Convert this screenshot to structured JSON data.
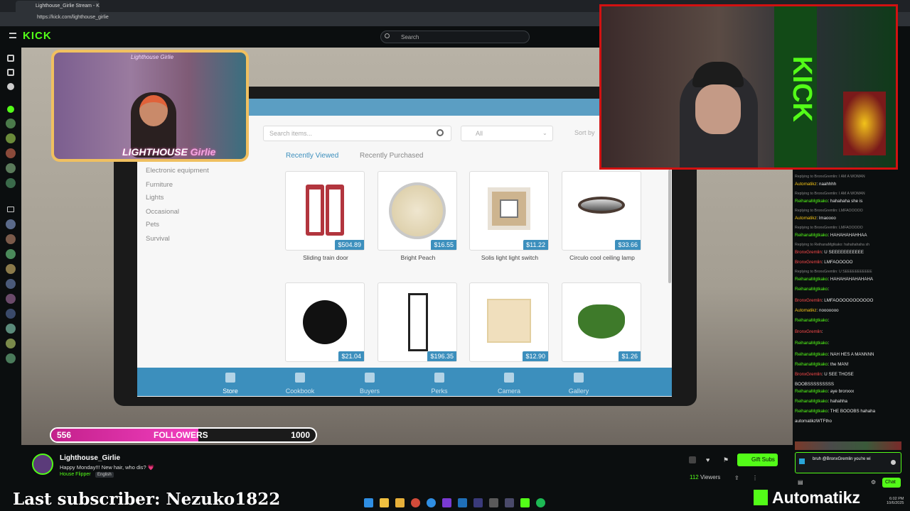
{
  "browser": {
    "tab_title": "Lighthouse_Girlie Stream - Ki",
    "url": "https://kick.com/lighthouse_girlie"
  },
  "kick": {
    "logo": "KICK",
    "search_placeholder": "Search"
  },
  "game": {
    "search_placeholder": "Search items...",
    "filter_value": "All",
    "sort_label": "Sort by",
    "tabs": [
      "Recently Viewed",
      "Recently Purchased"
    ],
    "categories": [
      "Electronic equipment",
      "Furniture",
      "Lights",
      "Occasional",
      "Pets",
      "Survival"
    ],
    "items_row1": [
      {
        "name": "Sliding train door",
        "price": "$504.89"
      },
      {
        "name": "Bright Peach",
        "price": "$16.55"
      },
      {
        "name": "Solis light light switch",
        "price": "$11.22"
      },
      {
        "name": "Circulo cool ceiling lamp",
        "price": "$33.66"
      }
    ],
    "items_row2": [
      {
        "name": "",
        "price": "$21.04"
      },
      {
        "name": "",
        "price": "$196.35"
      },
      {
        "name": "",
        "price": "$12.90"
      },
      {
        "name": "",
        "price": "$1.26"
      }
    ],
    "footer": [
      "Store",
      "Cookbook",
      "Buyers",
      "Perks",
      "Camera",
      "Gallery"
    ]
  },
  "overlay": {
    "cam_name": "Lighthouse Girlie",
    "cam_label": "LIGHTHOUSE",
    "cam_label2": "Girlie",
    "kick_banner": "KICK",
    "followers_count": "556",
    "followers_label": "FOLLOWERS",
    "followers_goal": "1000",
    "followers_progress": 0.556,
    "last_sub": "Last subscriber: Nezuko1822",
    "brand": "Automatikz"
  },
  "channel": {
    "name": "Lighthouse_Girlie",
    "title": "Happy Monday!!! New hair, who dis? 💗",
    "category": "House Flipper",
    "language": "English",
    "gift_label": "Gift Subs",
    "viewers_count": "112",
    "viewers_label": "Viewers"
  },
  "chat": {
    "lines": [
      {
        "reply": "Replying to BronxGremlin: I AM A WOMAN"
      },
      {
        "user": "Automatikz",
        "msg": ": naahhhh",
        "color": "y"
      },
      {
        "reply": "Replying to BronxGremlin: I AM A WOMAN"
      },
      {
        "user": "ReihanaMgtkako",
        "msg": ": hahahaha she is",
        "color": "g"
      },
      {
        "reply": "Replying to BronxGremlin: LMFAOOOOO"
      },
      {
        "user": "Automatikz",
        "msg": ": lmaoooo",
        "color": "y"
      },
      {
        "reply": "Replying to BronxGremlin: LMFAOOOOO"
      },
      {
        "user": "ReihanaMgtkako",
        "msg": ": HAHAHAHAHHAA",
        "color": "g"
      },
      {
        "reply": "Replying to ReihanaMgtkako: hahahahaha sh"
      },
      {
        "user": "BronxGremlin",
        "msg": ": U SEEEEEEEEEEE",
        "color": "r"
      },
      {
        "user": "BronxGremlin",
        "msg": ": LMFAOOOOO",
        "color": "r"
      },
      {
        "reply": "Replying to BronxGremlin: U SEEEEEEEEEEE"
      },
      {
        "user": "ReihanaMgtkako",
        "msg": ": HAHAHAHAHAHAHA",
        "color": "g"
      },
      {
        "user": "ReihanaMgtkako",
        "msg": ":",
        "color": "g"
      },
      {
        "user": "BronxGremlin",
        "msg": ": LMFAOOOOOOOOOOO",
        "color": "r"
      },
      {
        "user": "Automatikz",
        "msg": ": nooooooo",
        "color": "y"
      },
      {
        "user": "ReihanaMgtkako",
        "msg": ":",
        "color": "g"
      },
      {
        "user": "BronxGremlin",
        "msg": ":",
        "color": "r"
      },
      {
        "user": "ReihanaMgtkako",
        "msg": ":",
        "color": "g"
      },
      {
        "user": "ReihanaMgtkako",
        "msg": ": NAH HES A MANNNN",
        "color": "g"
      },
      {
        "user": "ReihanaMgtkako",
        "msg": ": the MAN!",
        "color": "g"
      },
      {
        "user": "BronxGremlin",
        "msg": ": U SEE THOSE",
        "color": "r"
      },
      {
        "cont": "BOOBSSSSSSSSS"
      },
      {
        "user": "ReihanaMgtkako",
        "msg": ": aye bronxxx",
        "color": "g"
      },
      {
        "user": "ReihanaMgtkako",
        "msg": ": hahahha",
        "color": "g"
      },
      {
        "user": "ReihanaMgtkako",
        "msg": ": THE BOOOBS hahaha",
        "color": "g"
      },
      {
        "user": "",
        "msg": "automatikzWTFtho",
        "color": "g"
      }
    ],
    "input_text": "bruh @BronxGremlin you're wi",
    "send_label": "Chat"
  },
  "clock": {
    "time": "6:02 PM",
    "date": "10/6/2025"
  },
  "colors": {
    "kick_green": "#53fc18",
    "store_blue": "#3c8fbd",
    "follow_pink": "#f23fc0",
    "cam_border": "#d21111"
  }
}
